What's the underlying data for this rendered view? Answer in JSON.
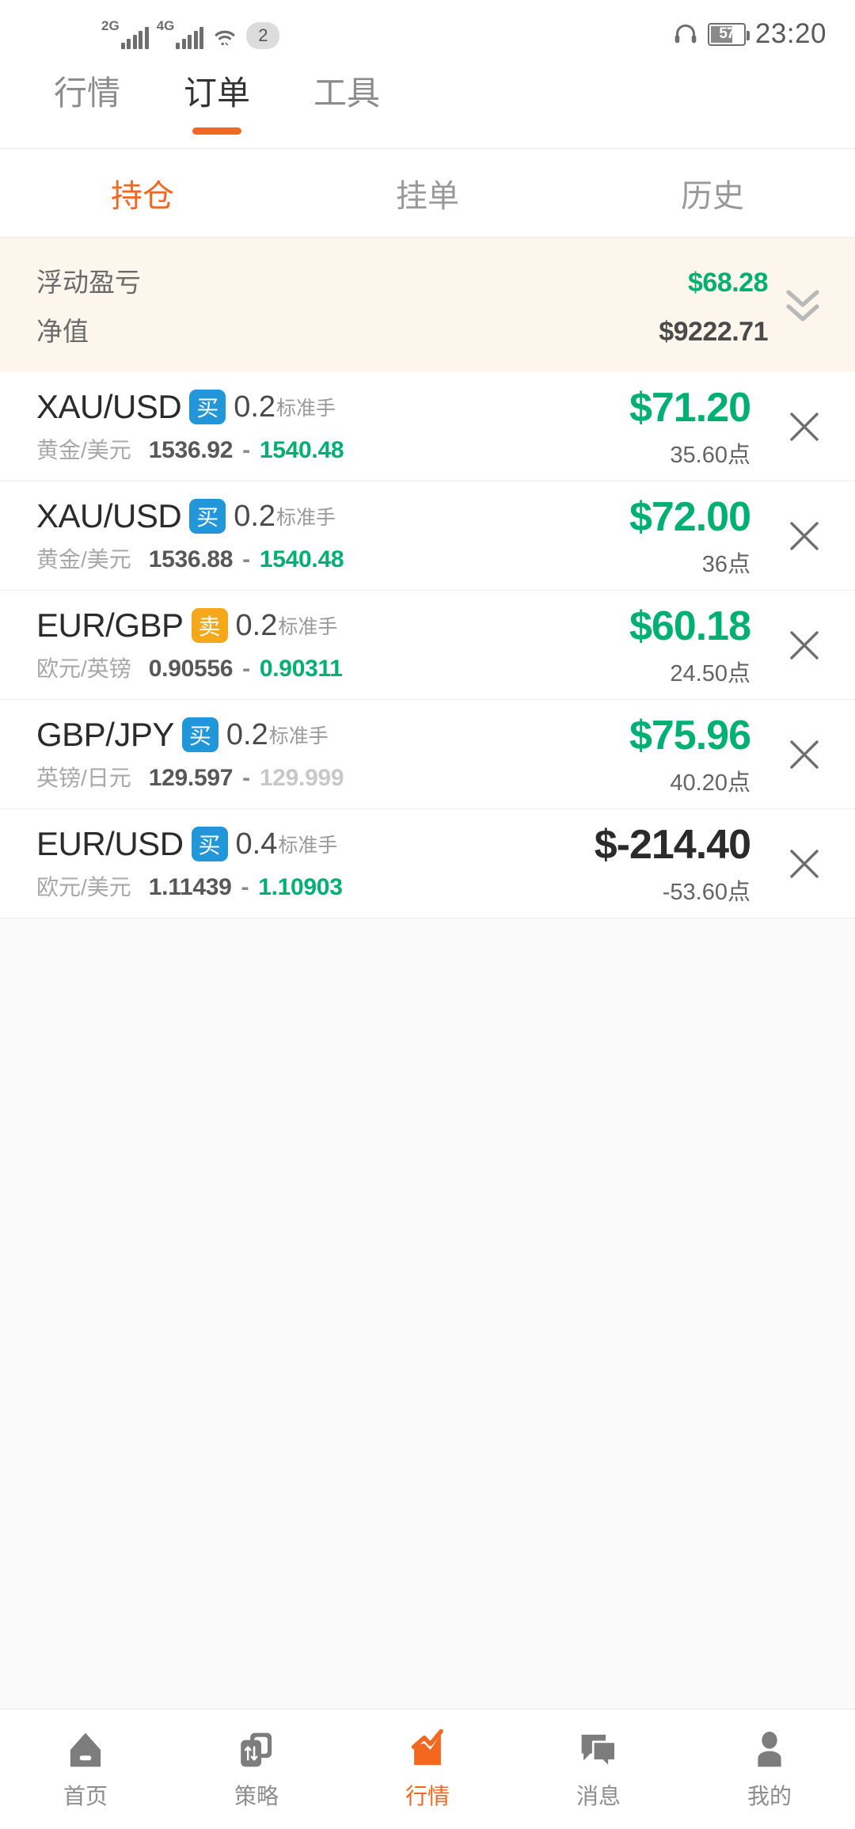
{
  "status_bar": {
    "network_1": "2G",
    "network_2": "4G",
    "wifi_icon": "wifi-icon",
    "notification_count": "2",
    "headset_icon": "headset-icon",
    "battery_level": "57",
    "time": "23:20"
  },
  "top_tabs": [
    {
      "label": "行情",
      "active": false
    },
    {
      "label": "订单",
      "active": true
    },
    {
      "label": "工具",
      "active": false
    }
  ],
  "sub_tabs": [
    {
      "label": "持仓",
      "active": true
    },
    {
      "label": "挂单",
      "active": false
    },
    {
      "label": "历史",
      "active": false
    }
  ],
  "summary": {
    "floating_pl_label": "浮动盈亏",
    "floating_pl_value": "$68.28",
    "equity_label": "净值",
    "equity_value": "$9222.71",
    "expand_icon": "double-chevron-down-icon"
  },
  "positions": [
    {
      "symbol": "XAU/USD",
      "direction": "买",
      "direction_type": "buy",
      "lots": "0.2",
      "lot_unit": "标准手",
      "cn_name": "黄金/美元",
      "open_price": "1536.92",
      "current_price": "1540.48",
      "current_price_color": "green",
      "pnl": "$71.20",
      "pnl_color": "green",
      "points": "35.60点",
      "close_icon": "close-icon"
    },
    {
      "symbol": "XAU/USD",
      "direction": "买",
      "direction_type": "buy",
      "lots": "0.2",
      "lot_unit": "标准手",
      "cn_name": "黄金/美元",
      "open_price": "1536.88",
      "current_price": "1540.48",
      "current_price_color": "green",
      "pnl": "$72.00",
      "pnl_color": "green",
      "points": "36点",
      "close_icon": "close-icon"
    },
    {
      "symbol": "EUR/GBP",
      "direction": "卖",
      "direction_type": "sell",
      "lots": "0.2",
      "lot_unit": "标准手",
      "cn_name": "欧元/英镑",
      "open_price": "0.90556",
      "current_price": "0.90311",
      "current_price_color": "green",
      "pnl": "$60.18",
      "pnl_color": "green",
      "points": "24.50点",
      "close_icon": "close-icon"
    },
    {
      "symbol": "GBP/JPY",
      "direction": "买",
      "direction_type": "buy",
      "lots": "0.2",
      "lot_unit": "标准手",
      "cn_name": "英镑/日元",
      "open_price": "129.597",
      "current_price": "129.999",
      "current_price_color": "grey",
      "pnl": "$75.96",
      "pnl_color": "green",
      "points": "40.20点",
      "close_icon": "close-icon"
    },
    {
      "symbol": "EUR/USD",
      "direction": "买",
      "direction_type": "buy",
      "lots": "0.4",
      "lot_unit": "标准手",
      "cn_name": "欧元/美元",
      "open_price": "1.11439",
      "current_price": "1.10903",
      "current_price_color": "green",
      "pnl": "$-214.40",
      "pnl_color": "dark",
      "points": "-53.60点",
      "close_icon": "close-icon"
    }
  ],
  "bottom_nav": [
    {
      "label": "首页",
      "icon": "home-icon",
      "active": false
    },
    {
      "label": "策略",
      "icon": "strategy-swap-icon",
      "active": false
    },
    {
      "label": "行情",
      "icon": "quotes-chart-icon",
      "active": true
    },
    {
      "label": "消息",
      "icon": "messages-icon",
      "active": false
    },
    {
      "label": "我的",
      "icon": "profile-icon",
      "active": false
    }
  ],
  "colors": {
    "accent_orange": "#f4671f",
    "profit_green": "#00b073",
    "buy_blue": "#2196d8",
    "sell_amber": "#f5a81c",
    "summary_bg": "#fdf6ec"
  }
}
